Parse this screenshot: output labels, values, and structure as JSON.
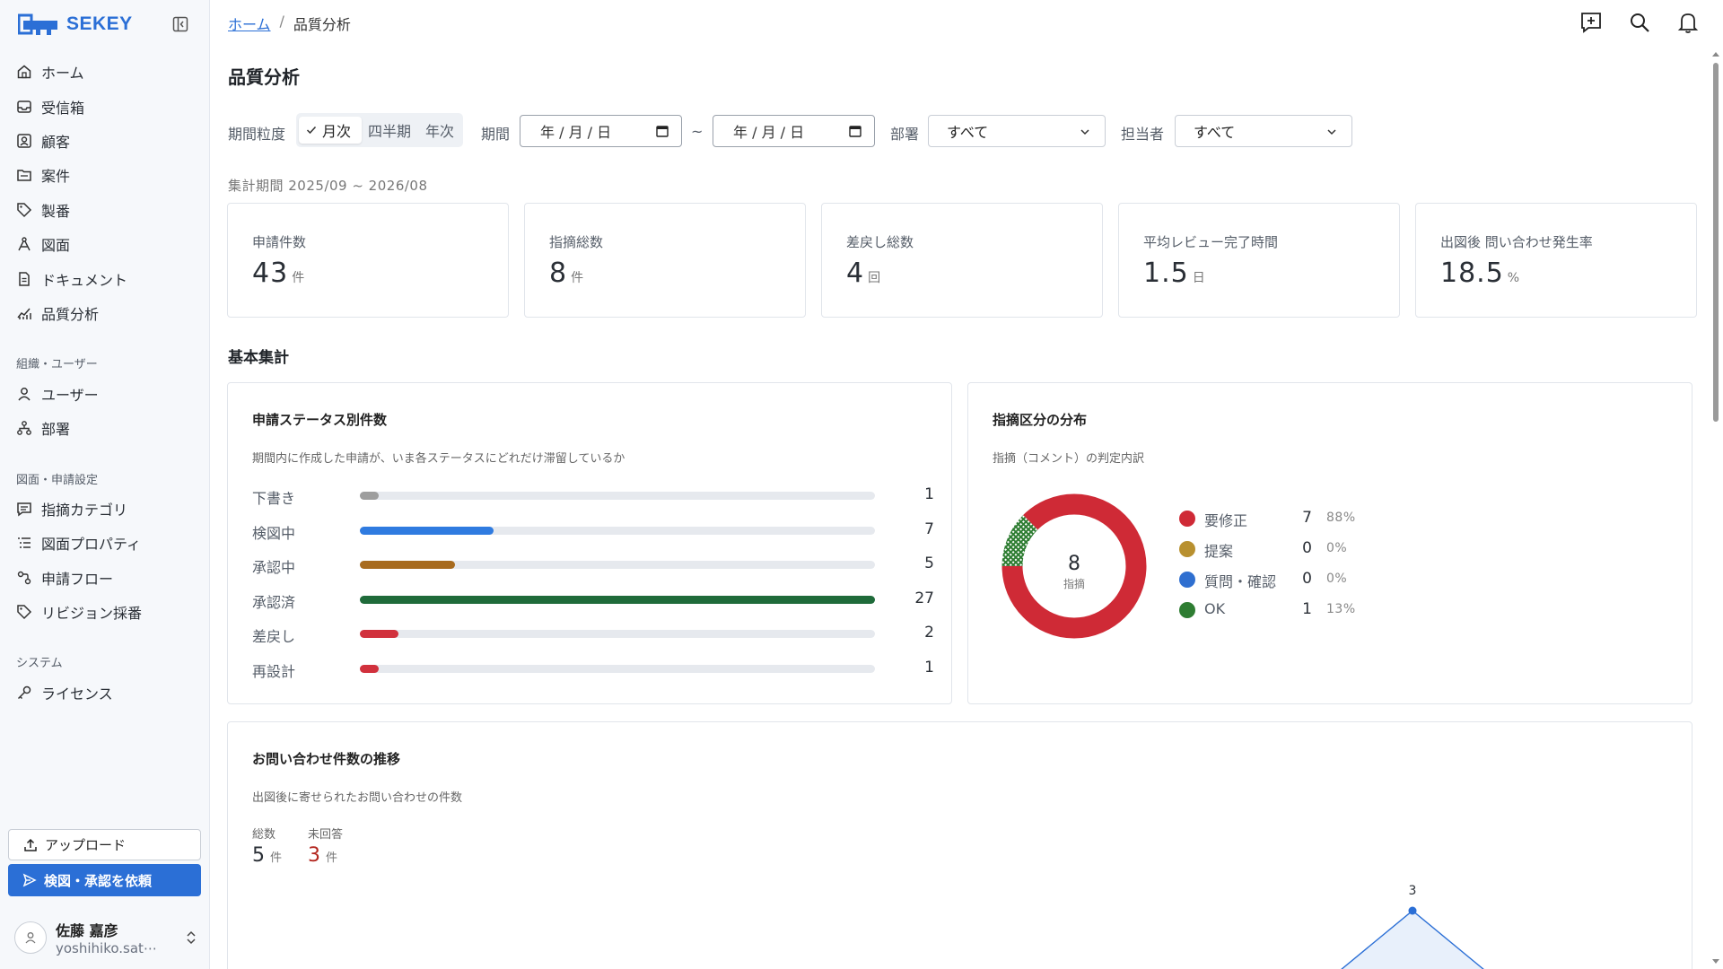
{
  "app": {
    "brand": "SEKEY"
  },
  "sidebar": {
    "nav": [
      {
        "label": "ホーム",
        "icon": "home-icon"
      },
      {
        "label": "受信箱",
        "icon": "inbox-icon"
      },
      {
        "label": "顧客",
        "icon": "customer-icon"
      },
      {
        "label": "案件",
        "icon": "folder-icon"
      },
      {
        "label": "製番",
        "icon": "tag-icon"
      },
      {
        "label": "図面",
        "icon": "drawing-icon"
      },
      {
        "label": "ドキュメント",
        "icon": "document-icon"
      },
      {
        "label": "品質分析",
        "icon": "chart-icon"
      }
    ],
    "section_org": "組織・ユーザー",
    "org": [
      {
        "label": "ユーザー",
        "icon": "user-icon"
      },
      {
        "label": "部署",
        "icon": "department-icon"
      }
    ],
    "section_settings": "図面・申請設定",
    "settings": [
      {
        "label": "指摘カテゴリ",
        "icon": "comment-category-icon"
      },
      {
        "label": "図面プロパティ",
        "icon": "property-list-icon"
      },
      {
        "label": "申請フロー",
        "icon": "flow-icon"
      },
      {
        "label": "リビジョン採番",
        "icon": "tag-icon"
      }
    ],
    "section_system": "システム",
    "system": [
      {
        "label": "ライセンス",
        "icon": "key-icon"
      }
    ],
    "upload_label": "アップロード",
    "request_label": "検図・承認を依頼",
    "user": {
      "name": "佐藤 嘉彦",
      "email": "yoshihiko.sat⋯"
    }
  },
  "header": {
    "breadcrumb_home": "ホーム",
    "breadcrumb_sep": "/",
    "breadcrumb_current": "品質分析"
  },
  "page": {
    "title": "品質分析"
  },
  "filters": {
    "granularity_label": "期間粒度",
    "granularity_options": [
      "月次",
      "四半期",
      "年次"
    ],
    "granularity_selected": "月次",
    "period_label": "期間",
    "date_from": "年 / 月 / 日",
    "date_to": "年 / 月 / 日",
    "tilde": "~",
    "department_label": "部署",
    "department_value": "すべて",
    "assignee_label": "担当者",
    "assignee_value": "すべて"
  },
  "period_range": "集計期間 2025/09 ~ 2026/08",
  "kpis": [
    {
      "label": "申請件数",
      "value": "43",
      "unit": "件"
    },
    {
      "label": "指摘総数",
      "value": "8",
      "unit": "件"
    },
    {
      "label": "差戻し総数",
      "value": "4",
      "unit": "回"
    },
    {
      "label": "平均レビュー完了時間",
      "value": "1.5",
      "unit": "日"
    },
    {
      "label": "出図後 問い合わせ発生率",
      "value": "18.5",
      "unit": "%"
    }
  ],
  "section_basic": "基本集計",
  "status_card": {
    "title": "申請ステータス別件数",
    "subtitle": "期間内に作成した申請が、いま各ステータスにどれだけ滞留しているか"
  },
  "distribution_card": {
    "title": "指摘区分の分布",
    "subtitle": "指摘（コメント）の判定内訳",
    "center_value": "8",
    "center_label": "指摘"
  },
  "inquiry_card": {
    "title": "お問い合わせ件数の推移",
    "subtitle": "出図後に寄せられたお問い合わせの件数",
    "total_label": "総数",
    "total_value": "5",
    "total_unit": "件",
    "unanswered_label": "未回答",
    "unanswered_value": "3",
    "unanswered_unit": "件",
    "peak_label": "3"
  },
  "chart_data": [
    {
      "type": "bar",
      "title": "申請ステータス別件数",
      "categories": [
        "下書き",
        "検図中",
        "承認中",
        "承認済",
        "差戻し",
        "再設計"
      ],
      "values": [
        1,
        7,
        5,
        27,
        2,
        1
      ],
      "colors": [
        "#9e9e9e",
        "#2f7be0",
        "#a86b1e",
        "#1f6b3a",
        "#d1313d",
        "#d1313d"
      ],
      "max": 27
    },
    {
      "type": "pie",
      "title": "指摘区分の分布",
      "categories": [
        "要修正",
        "提案",
        "質問・確認",
        "OK"
      ],
      "values": [
        7,
        0,
        0,
        1
      ],
      "percents": [
        "88%",
        "0%",
        "0%",
        "13%"
      ],
      "colors": [
        "#cf2a36",
        "#b8902f",
        "#2f6fd0",
        "#2e7d32"
      ]
    },
    {
      "type": "line",
      "title": "お問い合わせ件数の推移",
      "visible_peak": 3
    }
  ]
}
